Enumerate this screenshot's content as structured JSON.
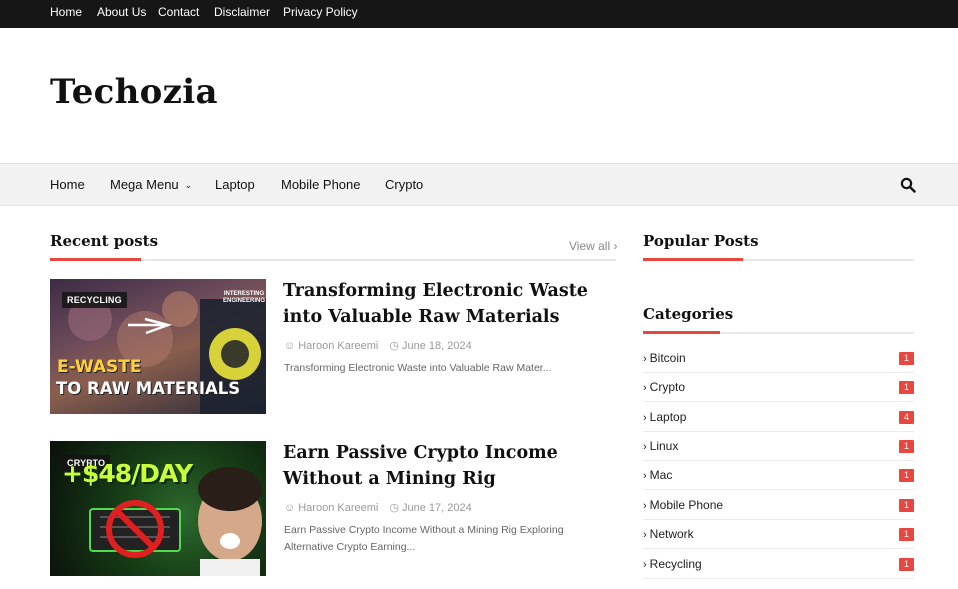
{
  "topbar": {
    "links": [
      {
        "label": "Home"
      },
      {
        "label": "About Us"
      },
      {
        "label": "Contact"
      },
      {
        "label": "Disclaimer"
      },
      {
        "label": "Privacy Policy"
      }
    ]
  },
  "site": {
    "title": "Techozia"
  },
  "mainnav": {
    "items": [
      {
        "label": "Home"
      },
      {
        "label": "Mega Menu"
      },
      {
        "label": "Laptop"
      },
      {
        "label": "Mobile Phone"
      },
      {
        "label": "Crypto"
      }
    ],
    "search_icon": "search-icon"
  },
  "recent": {
    "title": "Recent posts",
    "view_all": "View all"
  },
  "posts": [
    {
      "title": "Transforming Electronic Waste into Valuable Raw Materials",
      "author": "Haroon Kareemi",
      "date": "June 18, 2024",
      "excerpt": "Transforming Electronic Waste into Valuable Raw Mater...",
      "thumb": {
        "tag": "RECYCLING",
        "line1": "E-WASTE",
        "line2": "TO RAW MATERIALS",
        "brand": "INTERESTING ENGINEERING"
      }
    },
    {
      "title": "Earn Passive Crypto Income Without a Mining Rig",
      "author": "Haroon Kareemi",
      "date": "June 17, 2024",
      "excerpt": "Earn Passive Crypto Income Without a Mining Rig Exploring Alternative Crypto Earning...",
      "thumb": {
        "tag": "CRYPTO",
        "line1": "+$48/DAY"
      }
    }
  ],
  "sidebar": {
    "popular_title": "Popular Posts",
    "categories_title": "Categories",
    "categories": [
      {
        "label": "Bitcoin",
        "count": "1"
      },
      {
        "label": "Crypto",
        "count": "1"
      },
      {
        "label": "Laptop",
        "count": "4"
      },
      {
        "label": "Linux",
        "count": "1"
      },
      {
        "label": "Mac",
        "count": "1"
      },
      {
        "label": "Mobile Phone",
        "count": "1"
      },
      {
        "label": "Network",
        "count": "1"
      },
      {
        "label": "Recycling",
        "count": "1"
      }
    ]
  },
  "colors": {
    "accent": "#e8473f",
    "topbar_bg": "#161616",
    "nav_bg": "#f2f2f2"
  }
}
